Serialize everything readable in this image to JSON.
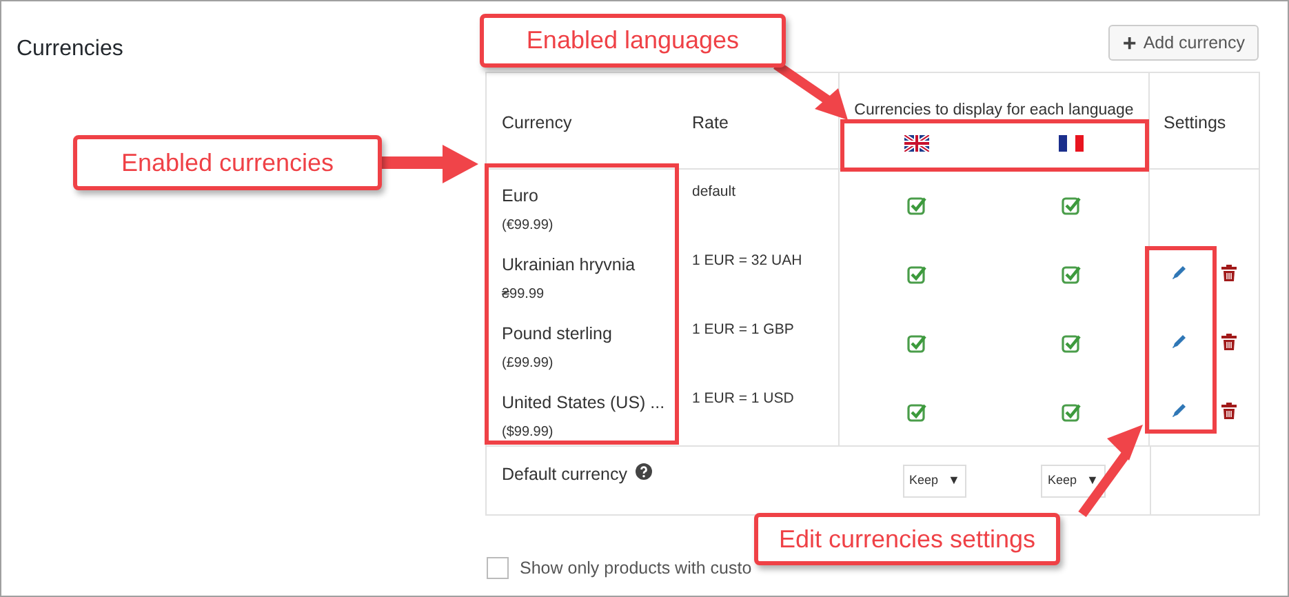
{
  "title": "Currencies",
  "add_button": {
    "label": "Add currency",
    "icon": "+"
  },
  "table": {
    "columns": [
      "Currency",
      "Rate",
      "Currencies to display for each language",
      "Settings"
    ],
    "languages": [
      {
        "kind": "union-jack"
      },
      {
        "kind": "tricolor"
      }
    ],
    "rows": [
      {
        "name": "Euro",
        "price": "(€99.99)",
        "rate": "default",
        "enabled": [
          true,
          true
        ],
        "actions": false
      },
      {
        "name": "Ukrainian hryvnia",
        "price": "₴99.99",
        "rate": "1 EUR = 32 UAH",
        "enabled": [
          true,
          true
        ],
        "actions": true
      },
      {
        "name": "Pound sterling",
        "price": "(£99.99)",
        "rate": "1 EUR = 1 GBP",
        "enabled": [
          true,
          true
        ],
        "actions": true
      },
      {
        "name": "United States (US) ...",
        "price": "($99.99)",
        "rate": "1 EUR = 1 USD",
        "enabled": [
          true,
          true
        ],
        "actions": true
      }
    ],
    "default_row": {
      "label": "Default currency",
      "selects": [
        {
          "value": "Keep",
          "caret": "▼"
        },
        {
          "value": "Keep",
          "caret": "▼"
        }
      ]
    }
  },
  "filter": {
    "label": "Show only products with custo",
    "checked": false
  },
  "annotations": [
    {
      "text": "Enabled languages"
    },
    {
      "text": "Enabled currencies"
    },
    {
      "text": "Edit currencies settings"
    }
  ]
}
